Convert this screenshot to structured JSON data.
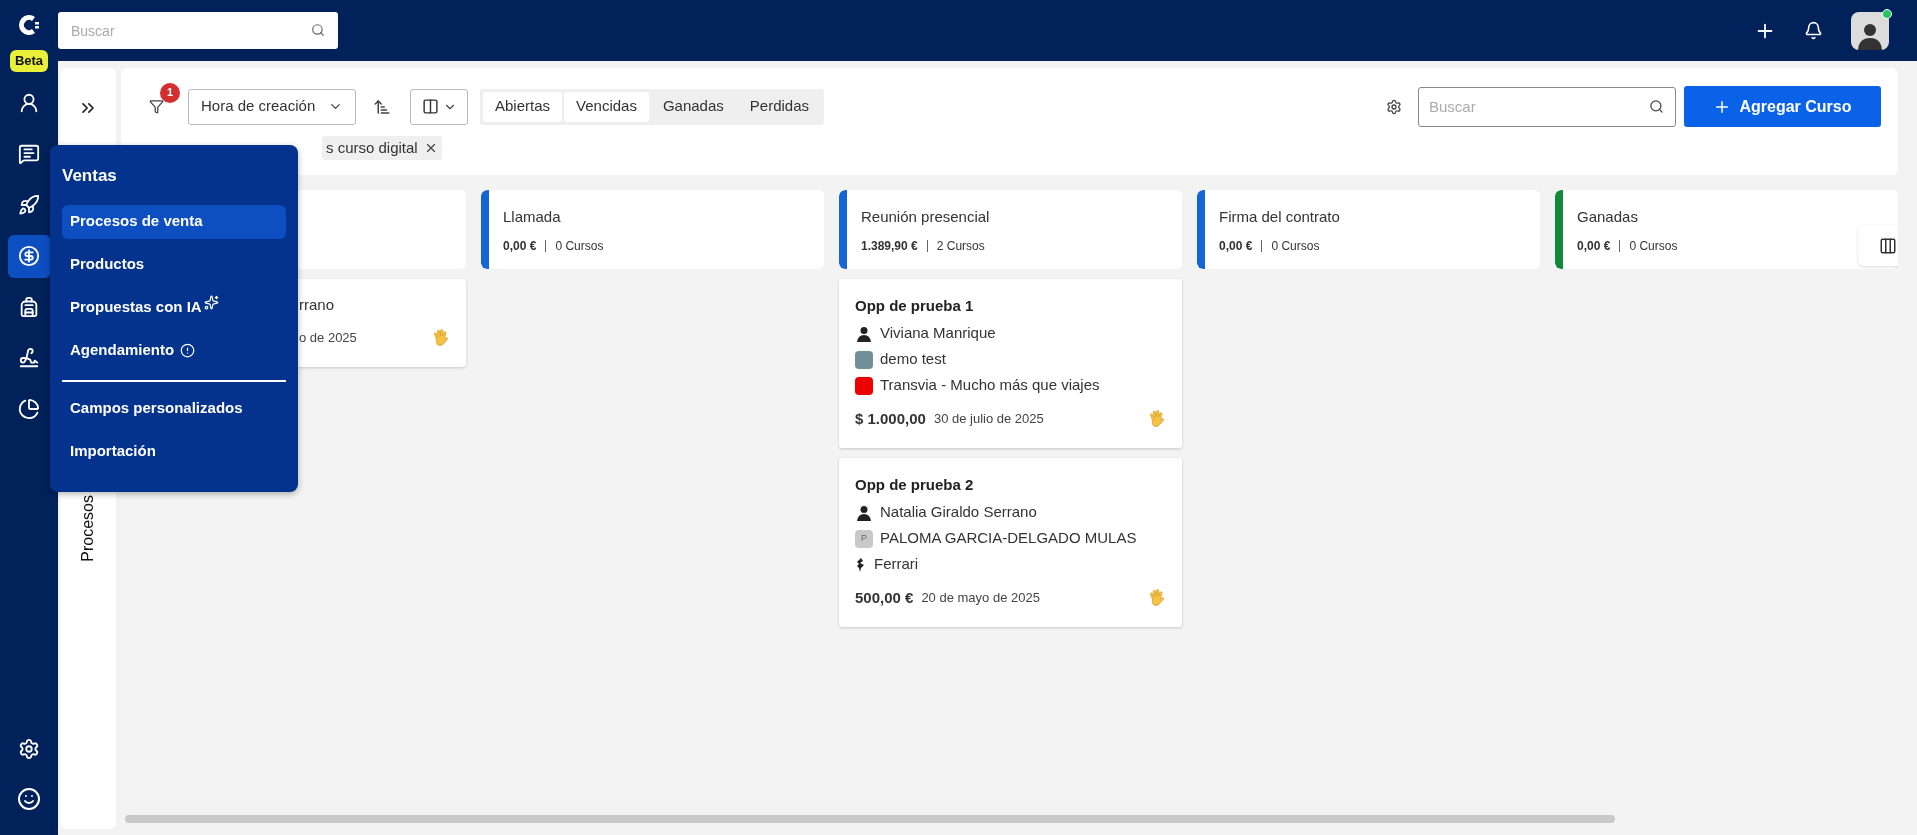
{
  "topbar": {
    "badge": "Beta",
    "search": {
      "placeholder": "Buscar"
    },
    "user": {
      "online": true
    }
  },
  "rail": [
    {
      "selected": false
    },
    {
      "selected": false
    },
    {
      "selected": false
    },
    {
      "selected": true
    },
    {
      "selected": false
    },
    {
      "selected": false
    },
    {
      "selected": false
    }
  ],
  "side_panel": {
    "label": "Procesos"
  },
  "toolbar": {
    "filter_count": "1",
    "sort_field": "Hora de creación",
    "status_tabs": [
      {
        "label": "Abiertas",
        "selected": true
      },
      {
        "label": "Vencidas",
        "selected": true
      },
      {
        "label": "Ganadas",
        "selected": false
      },
      {
        "label": "Perdidas",
        "selected": false
      }
    ],
    "search": {
      "placeholder": "Buscar"
    },
    "add_button": "Agregar Curso"
  },
  "filters": [
    {
      "label": "s curso digital"
    }
  ],
  "menu": {
    "title": "Ventas",
    "sections": [
      {
        "items": [
          {
            "label": "Procesos de venta",
            "selected": true,
            "kind": "link"
          },
          {
            "label": "Productos",
            "selected": false,
            "kind": "link"
          },
          {
            "label": "Propuestas con IA",
            "selected": false,
            "kind": "ai"
          },
          {
            "label": "Agendamiento",
            "selected": false,
            "kind": "info"
          }
        ]
      },
      {
        "items": [
          {
            "label": "Campos personalizados",
            "selected": false,
            "kind": "link"
          },
          {
            "label": "Importación",
            "selected": false,
            "kind": "link"
          }
        ]
      }
    ]
  },
  "stages": [
    {
      "cards": [
        {
          "contacts": [
            {
              "kind": "text",
              "text": "rrano"
            }
          ],
          "date": "o de 2025"
        }
      ]
    },
    {
      "title": "Llamada",
      "amount": "0,00 €",
      "count": "0 Cursos",
      "color": "#1565d8"
    },
    {
      "title": "Reunión presencial",
      "amount": "1.389,90 €",
      "count": "2 Cursos",
      "color": "#1565d8",
      "cards": [
        {
          "title": "Opp de prueba 1",
          "contacts": [
            {
              "kind": "person",
              "text": "Viviana Manrique"
            },
            {
              "kind": "photo",
              "text": "demo test"
            },
            {
              "kind": "logo",
              "text": "Transvia - Mucho más que viajes"
            }
          ],
          "amount": "$ 1.000,00",
          "date": "30 de julio de 2025"
        },
        {
          "title": "Opp de prueba 2",
          "contacts": [
            {
              "kind": "person",
              "text": "Natalia Giraldo Serrano"
            },
            {
              "kind": "initial",
              "initial": "P",
              "text": "PALOMA GARCIA-DELGADO MULAS"
            },
            {
              "kind": "mark",
              "text": "Ferrari"
            }
          ],
          "amount": "500,00 €",
          "date": "20 de mayo de 2025"
        }
      ]
    },
    {
      "title": "Firma del contrato",
      "amount": "0,00 €",
      "count": "0 Cursos",
      "color": "#1565d8"
    },
    {
      "title": "Ganadas",
      "amount": "0,00 €",
      "count": "0 Cursos",
      "color": "#138a3a"
    }
  ]
}
